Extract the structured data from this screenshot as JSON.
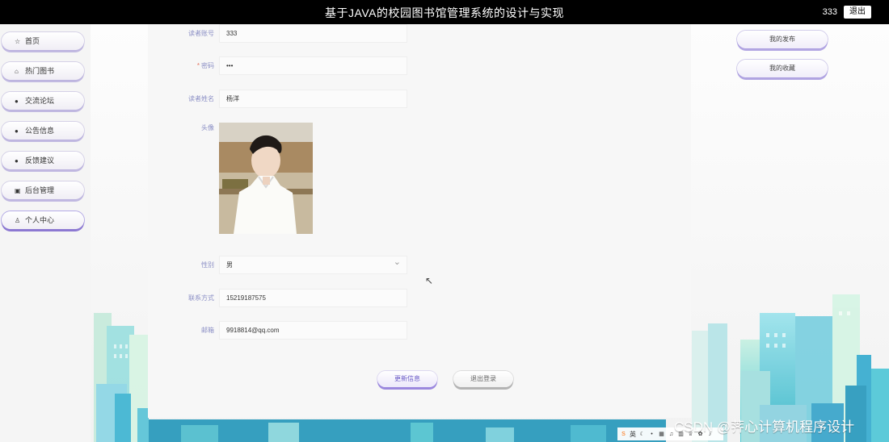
{
  "header": {
    "title": "基于JAVA的校园图书馆管理系统的设计与实现",
    "username": "333",
    "logout_label": "退出"
  },
  "sidebar": {
    "items": [
      {
        "label": "首页",
        "icon": "star-icon"
      },
      {
        "label": "热门图书",
        "icon": "shopping-bag-icon"
      },
      {
        "label": "交流论坛",
        "icon": "info-circle-icon"
      },
      {
        "label": "公告信息",
        "icon": "question-circle-icon"
      },
      {
        "label": "反馈建议",
        "icon": "info-circle-icon"
      },
      {
        "label": "后台管理",
        "icon": "printer-icon"
      },
      {
        "label": "个人中心",
        "icon": "user-icon",
        "active": true
      }
    ]
  },
  "profile_form": {
    "account": {
      "label": "读者账号",
      "value": "333"
    },
    "password": {
      "label": "密码",
      "required_mark": "*",
      "value": "•••"
    },
    "name": {
      "label": "读者姓名",
      "value": "杨洋"
    },
    "avatar": {
      "label": "头像"
    },
    "gender": {
      "label": "性别",
      "value": "男"
    },
    "phone": {
      "label": "联系方式",
      "value": "15219187575"
    },
    "email": {
      "label": "邮箱",
      "value": "9918814@qq.com"
    }
  },
  "actions": {
    "update_label": "更新信息",
    "logout_label": "退出登录"
  },
  "right_menu": {
    "items": [
      {
        "label": "我的发布"
      },
      {
        "label": "我的收藏"
      }
    ]
  },
  "tray": {
    "input_method": "英"
  },
  "watermark": {
    "text": "CSDN @荠心计算机程序设计"
  },
  "colors": {
    "accent": "#8b8fc5",
    "required": "#e4735e",
    "header_background": "#000000"
  }
}
